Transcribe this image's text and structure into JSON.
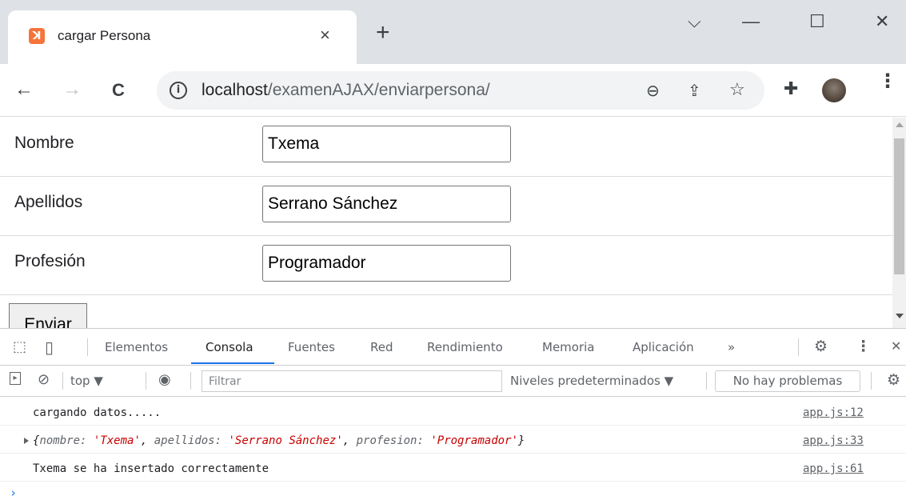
{
  "colors": {
    "tab_strip_bg": "#dee1e6",
    "accent_blue": "#1a73e8",
    "favicon_orange": "#f4743b",
    "console_string_red": "#c80000"
  },
  "browser": {
    "tab": {
      "favicon": "xampp-icon",
      "favicon_glyph": "ꓘ",
      "title": "cargar Persona",
      "close_glyph": "×"
    },
    "new_tab_glyph": "+",
    "window_controls": {
      "dropdown": "⌵",
      "minimize": "—",
      "maximize": "☐",
      "close": "✕"
    },
    "toolbar": {
      "back": "←",
      "forward": "→",
      "reload": "C",
      "info_glyph": "i",
      "url_host": "localhost",
      "url_path": "/examenAJAX/enviarpersona/",
      "zoom_glyph": "⊖",
      "share_glyph": "⇪",
      "star_glyph": "☆",
      "extensions_glyph": "✚",
      "menu_glyph": "⋮"
    }
  },
  "page": {
    "fields": [
      {
        "label": "Nombre",
        "value": "Txema"
      },
      {
        "label": "Apellidos",
        "value": "Serrano Sánchez"
      },
      {
        "label": "Profesión",
        "value": "Programador"
      }
    ],
    "submit_label": "Enviar"
  },
  "devtools": {
    "tabs": [
      "Elementos",
      "Consola",
      "Fuentes",
      "Red",
      "Rendimiento",
      "Memoria",
      "Aplicación"
    ],
    "active_tab": "Consola",
    "more_glyph": "»",
    "settings_glyph": "⚙",
    "menu_glyph": "⋮",
    "close_glyph": "✕",
    "inspect_glyph": "⬚",
    "device_glyph": "▯",
    "filterbar": {
      "sidebar_glyph": "▸",
      "clear_glyph": "⊘",
      "context": "top ▼",
      "eye_glyph": "◉",
      "filter_placeholder": "Filtrar",
      "levels": "Niveles predeterminados ▼",
      "issues": "No hay problemas",
      "settings_glyph": "⚙"
    },
    "console": [
      {
        "message": "cargando datos.....",
        "source": "app.js:12"
      },
      {
        "object": {
          "open": "{",
          "k1": "nombre: ",
          "v1": "'Txema'",
          "sep1": ", ",
          "k2": "apellidos: ",
          "v2": "'Serrano Sánchez'",
          "sep2": ", ",
          "k3": "profesion: ",
          "v3": "'Programador'",
          "close": "}"
        },
        "source": "app.js:33"
      },
      {
        "message": "Txema se ha insertado correctamente",
        "source": "app.js:61"
      }
    ],
    "prompt": "›"
  }
}
